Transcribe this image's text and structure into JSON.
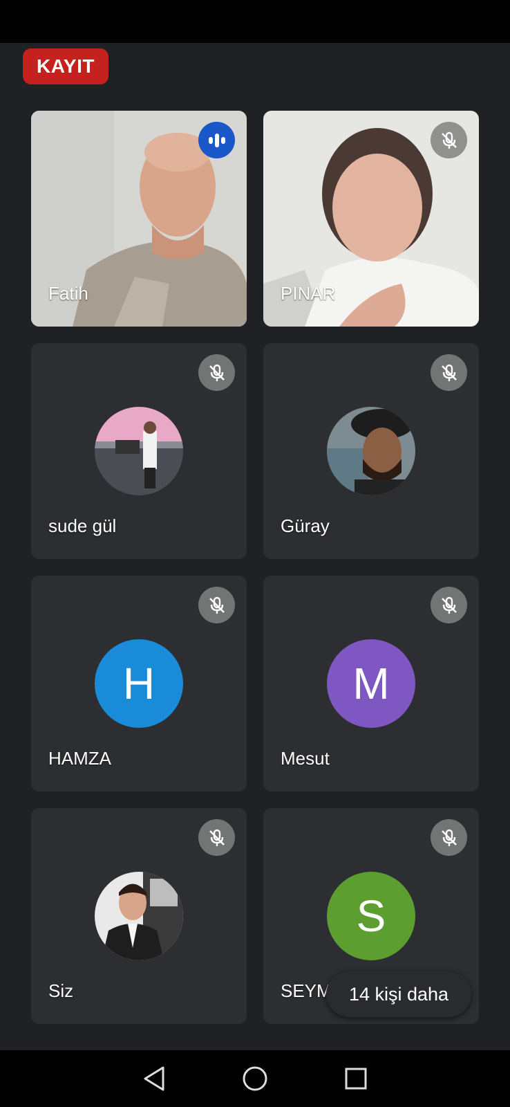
{
  "recording_badge": "KAYIT",
  "participants": [
    {
      "name": "Fatih",
      "status": "speaking"
    },
    {
      "name": "PINAR",
      "status": "muted"
    },
    {
      "name": "sude gül",
      "status": "muted"
    },
    {
      "name": "Güray",
      "status": "muted"
    },
    {
      "name": "HAMZA",
      "status": "muted",
      "initial": "H",
      "color": "#1a8bd8"
    },
    {
      "name": "Mesut",
      "status": "muted",
      "initial": "M",
      "color": "#7e57c2"
    },
    {
      "name": "Siz",
      "status": "muted"
    },
    {
      "name": "SEYMA",
      "status": "muted",
      "initial": "S",
      "color": "#5c9e2f"
    }
  ],
  "more_participants": "14 kişi daha",
  "colors": {
    "background": "#202124",
    "tile": "#2d2e31",
    "record": "#c5221f",
    "speaking": "#1a57c8"
  }
}
